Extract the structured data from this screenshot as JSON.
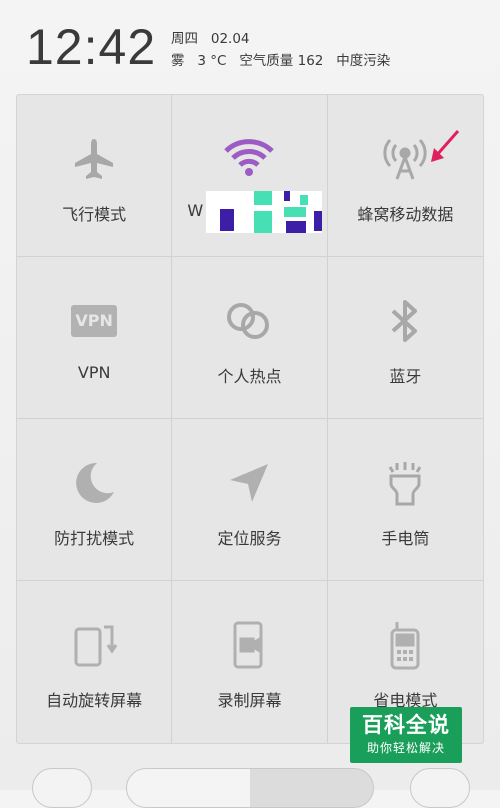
{
  "header": {
    "time": "12:42",
    "weekday": "周四",
    "date": "02.04",
    "weather": "雾",
    "temperature": "3 °C",
    "air_quality_label": "空气质量 162",
    "pollution_level": "中度污染"
  },
  "tiles": [
    {
      "label": "飞行模式",
      "icon": "airplane-icon"
    },
    {
      "label": "W",
      "icon": "wifi-icon"
    },
    {
      "label": "蜂窝移动数据",
      "icon": "cellular-tower-icon"
    },
    {
      "label": "VPN",
      "icon": "vpn-icon"
    },
    {
      "label": "个人热点",
      "icon": "hotspot-icon"
    },
    {
      "label": "蓝牙",
      "icon": "bluetooth-icon"
    },
    {
      "label": "防打扰模式",
      "icon": "moon-icon"
    },
    {
      "label": "定位服务",
      "icon": "location-arrow-icon"
    },
    {
      "label": "手电筒",
      "icon": "flashlight-icon"
    },
    {
      "label": "自动旋转屏幕",
      "icon": "rotate-screen-icon"
    },
    {
      "label": "录制屏幕",
      "icon": "screen-record-icon"
    },
    {
      "label": "省电模式",
      "icon": "power-saving-icon"
    }
  ],
  "vpn_badge": "VPN",
  "watermark": {
    "title": "百科全说",
    "subtitle": "助你轻松解决"
  },
  "colors": {
    "wifi_active": "#9c5cc4",
    "icon_gray": "#a8a8a8",
    "arrow": "#e0205c",
    "watermark_bg": "#1a9f5a"
  }
}
